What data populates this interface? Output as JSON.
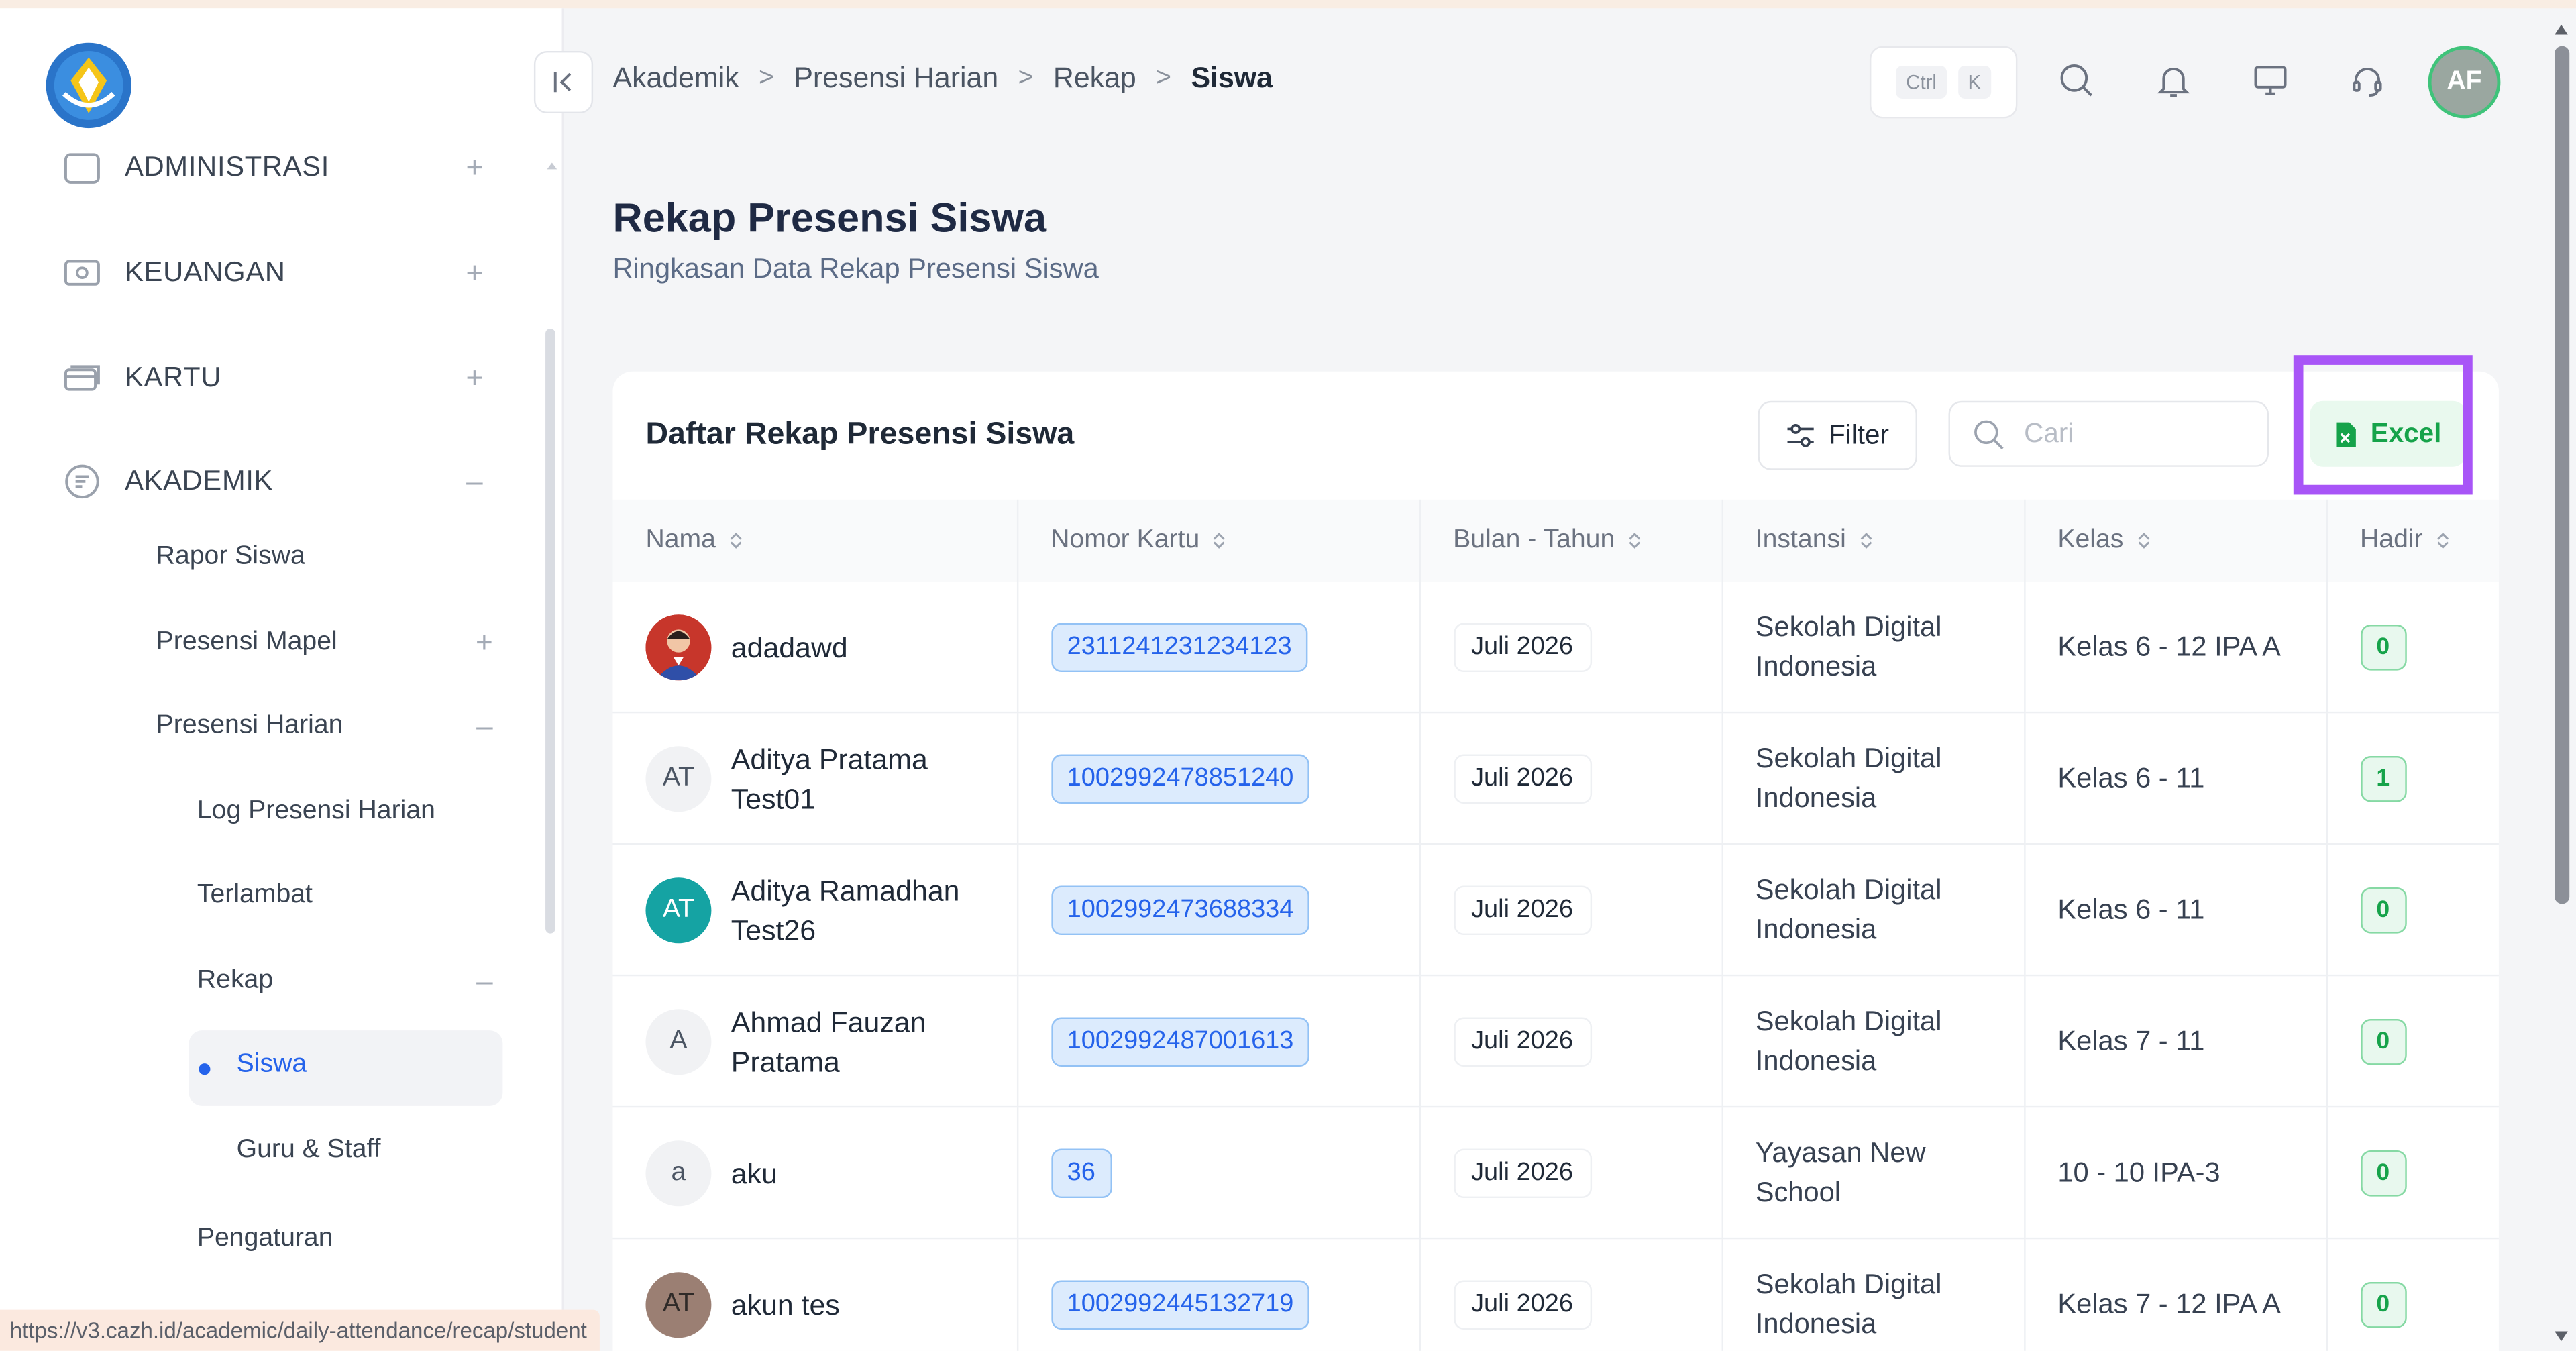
{
  "sidebar": {
    "menu": [
      {
        "label": "ADMINISTRASI",
        "toggle": "+"
      },
      {
        "label": "KEUANGAN",
        "toggle": "+"
      },
      {
        "label": "KARTU",
        "toggle": "+"
      },
      {
        "label": "AKADEMIK",
        "toggle": "–"
      }
    ],
    "akademik": {
      "rapor": "Rapor Siswa",
      "presensi_mapel": "Presensi Mapel",
      "presensi_mapel_toggle": "+",
      "presensi_harian": "Presensi Harian",
      "presensi_harian_toggle": "–",
      "log": "Log Presensi Harian",
      "terlambat": "Terlambat",
      "rekap": "Rekap",
      "rekap_toggle": "–",
      "siswa": "Siswa",
      "guru": "Guru & Staff",
      "pengaturan": "Pengaturan"
    },
    "status_url": "https://v3.cazh.id/academic/daily-attendance/recap/student"
  },
  "header": {
    "breadcrumb": [
      "Akademik",
      "Presensi Harian",
      "Rekap",
      "Siswa"
    ],
    "breadcrumb_sep": ">",
    "shortcut": [
      "Ctrl",
      "K"
    ],
    "user_initials": "AF"
  },
  "page": {
    "title": "Rekap Presensi Siswa",
    "subtitle": "Ringkasan Data Rekap Presensi Siswa"
  },
  "card": {
    "title": "Daftar Rekap Presensi Siswa",
    "filter_label": "Filter",
    "search_placeholder": "Cari",
    "excel_label": "Excel"
  },
  "table": {
    "columns": [
      "Nama",
      "Nomor Kartu",
      "Bulan - Tahun",
      "Instansi",
      "Kelas",
      "Hadir"
    ],
    "rows": [
      {
        "avatar": "",
        "avatar_style": "photo",
        "name": "adadawd",
        "card": "2311241231234123",
        "month": "Juli 2026",
        "inst": "Sekolah Digital Indonesia",
        "kelas": "Kelas 6 - 12 IPA A",
        "hadir": "0"
      },
      {
        "avatar": "AT",
        "avatar_style": "gray",
        "name": "Aditya Pratama Test01",
        "card": "1002992478851240",
        "month": "Juli 2026",
        "inst": "Sekolah Digital Indonesia",
        "kelas": "Kelas 6 - 11",
        "hadir": "1"
      },
      {
        "avatar": "AT",
        "avatar_style": "teal",
        "name": "Aditya Ramadhan Test26",
        "card": "1002992473688334",
        "month": "Juli 2026",
        "inst": "Sekolah Digital Indonesia",
        "kelas": "Kelas 6 - 11",
        "hadir": "0"
      },
      {
        "avatar": "A",
        "avatar_style": "gray",
        "name": "Ahmad Fauzan Pratama",
        "card": "1002992487001613",
        "month": "Juli 2026",
        "inst": "Sekolah Digital Indonesia",
        "kelas": "Kelas 7 - 11",
        "hadir": "0"
      },
      {
        "avatar": "a",
        "avatar_style": "gray",
        "name": "aku",
        "card": "36",
        "month": "Juli 2026",
        "inst": "Yayasan New School",
        "kelas": "10 - 10 IPA-3",
        "hadir": "0"
      },
      {
        "avatar": "AT",
        "avatar_style": "brown",
        "name": "akun tes",
        "card": "1002992445132719",
        "month": "Juli 2026",
        "inst": "Sekolah Digital Indonesia",
        "kelas": "Kelas 7 - 12 IPA A",
        "hadir": "0"
      }
    ]
  },
  "colors": {
    "accent": "#2563eb",
    "excel_green": "#16a34a",
    "highlight": "#a855f7",
    "avatar_teal": "#15a3a3"
  }
}
